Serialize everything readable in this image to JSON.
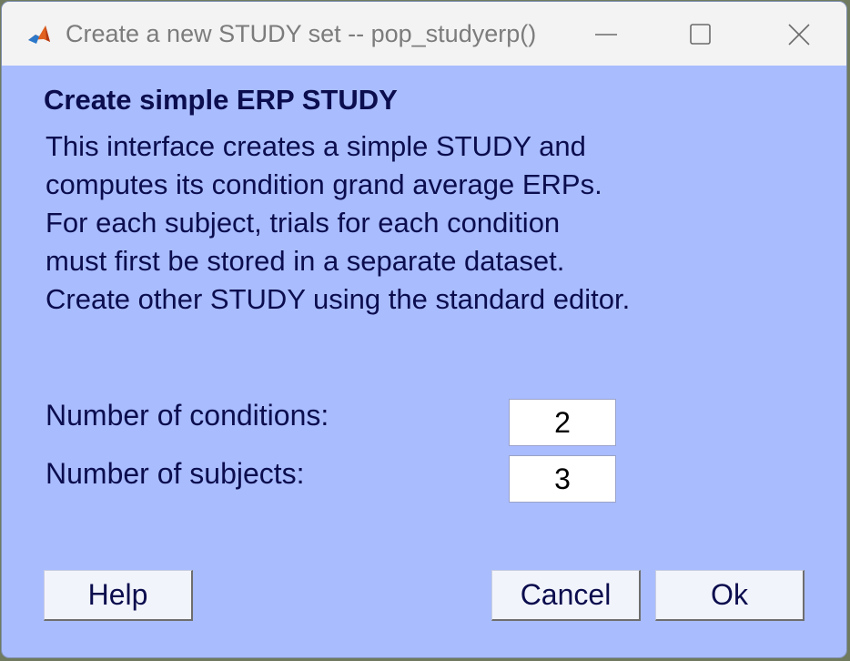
{
  "window": {
    "title": "Create a new STUDY set -- pop_studyerp()",
    "app_icon": "matlab-icon",
    "controls": [
      "minimize-icon",
      "maximize-icon",
      "close-icon"
    ]
  },
  "content": {
    "heading": "Create simple ERP STUDY",
    "description_lines": [
      "This interface creates a simple STUDY and",
      "computes its condition grand average ERPs.",
      "For each subject, trials for each condition",
      "must first be stored in a separate dataset.",
      "Create other STUDY using the standard editor."
    ],
    "fields": {
      "conditions": {
        "label": "Number of conditions:",
        "value": "2"
      },
      "subjects": {
        "label": "Number of subjects:",
        "value": "3"
      }
    }
  },
  "buttons": {
    "help": "Help",
    "cancel": "Cancel",
    "ok": "Ok"
  },
  "colors": {
    "dialog_background": "#a9bcfe",
    "text": "#0b0d4e",
    "titlebar": "#f3f3f3"
  }
}
